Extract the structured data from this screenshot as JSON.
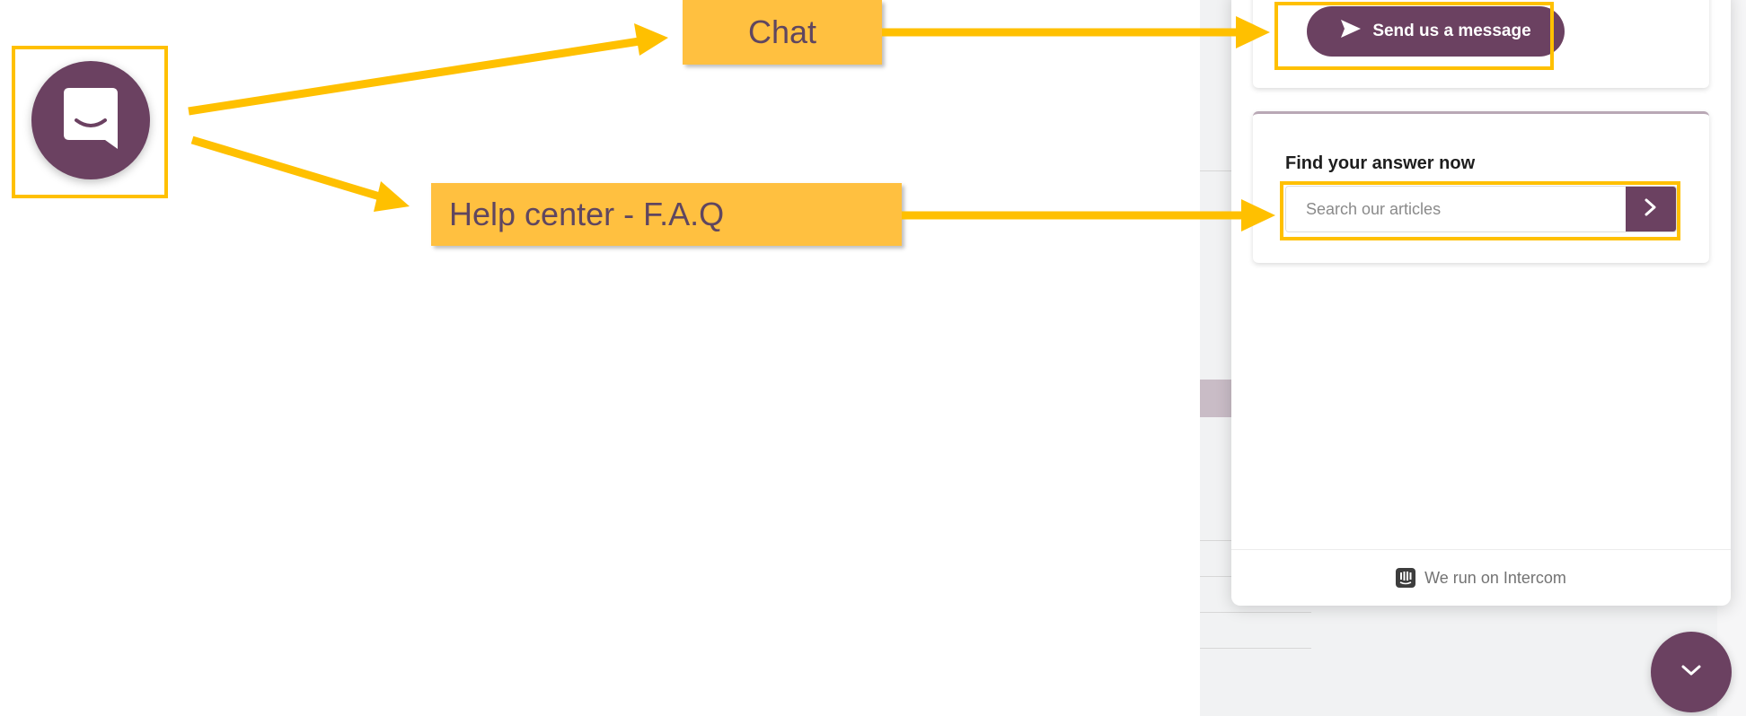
{
  "annotations": {
    "chat_label": "Chat",
    "help_label": "Help center - F.A.Q"
  },
  "messenger": {
    "send_button_label": "Send us a message",
    "help_title": "Find your answer now",
    "search_placeholder": "Search our articles",
    "footer_text": "We run on Intercom"
  },
  "icons": {
    "launcher": "chat-bubble-smile-icon",
    "send": "paper-plane-icon",
    "search_go": "chevron-right-icon",
    "footer_logo": "intercom-logo-icon",
    "collapse": "chevron-down-icon"
  },
  "colors": {
    "brand": "#6b4161",
    "highlight": "#ffc000",
    "callout": "#ffc040",
    "callout_text": "#5f4660"
  }
}
